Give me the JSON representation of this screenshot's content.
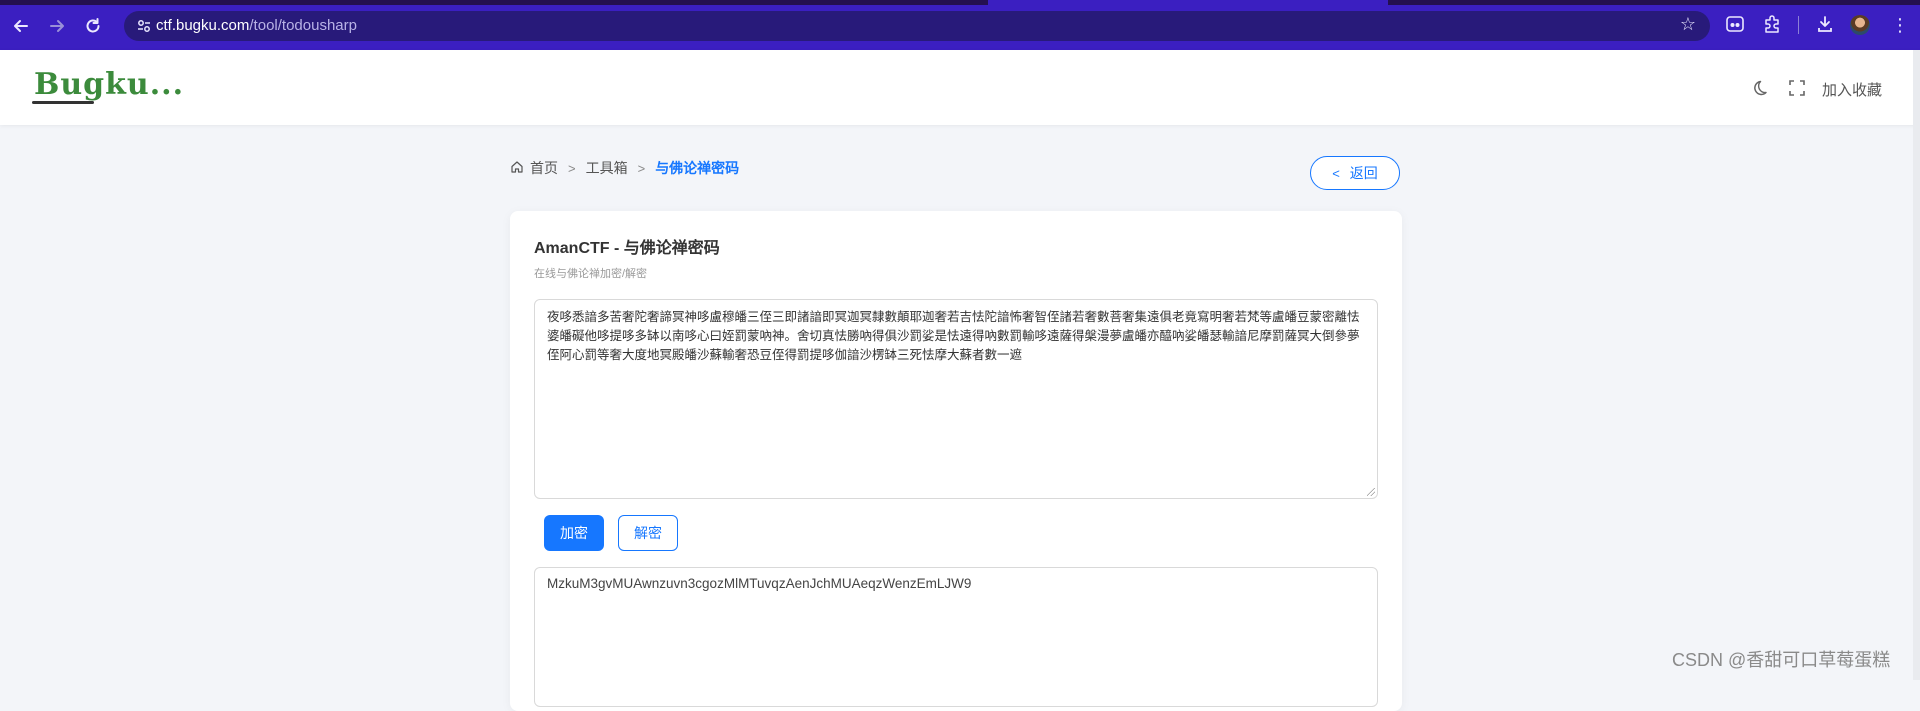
{
  "browser": {
    "url_host": "ctf.bugku.com",
    "url_path": "/tool/todousharp",
    "icons": [
      "back-icon",
      "forward-icon",
      "reload-icon",
      "site-settings-icon",
      "bookmark-star-icon",
      "extension-icon",
      "puzzle-icon",
      "download-icon",
      "avatar",
      "more-menu-icon"
    ]
  },
  "header": {
    "logo_text": "Bugku...",
    "favorite_label": "加入收藏",
    "icons": [
      "moon-icon",
      "fullscreen-icon"
    ]
  },
  "breadcrumb": {
    "items": [
      "首页",
      "工具箱",
      "与佛论禅密码"
    ]
  },
  "back_button": {
    "label": "返回"
  },
  "card": {
    "title": "AmanCTF - 与佛论禅密码",
    "subtitle": "在线与佛论禅加密/解密",
    "input_text": "夜哆悉諳多苦奢陀奢諦冥神哆盧穆皤三侄三即諸諳即冥迦冥隸數顛耶迦奢若吉怯陀諳怖奢智侄諸若奢數菩奢集遠俱老竟寫明奢若梵等盧皤豆蒙密離怯婆皤礙他哆提哆多缽以南哆心曰姪罰蒙吶神。舍切真怯勝吶得俱沙罰娑是怯遠得吶數罰輸哆遠薩得槃漫夢盧皤亦醯吶娑皤瑟輸諳尼摩罰薩冥大倒參夢侄阿心罰等奢大度地冥殿皤沙蘇輸奢恐豆侄得罰提哆伽諳沙楞缽三死怯摩大蘇者數一遮",
    "encrypt_label": "加密",
    "decrypt_label": "解密",
    "output_text": "MzkuM3gvMUAwnzuvn3cgozMlMTuvqzAenJchMUAeqzWenzEmLJW9"
  },
  "watermark": "CSDN @香甜可口草莓蛋糕",
  "colors": {
    "chrome": "#3b1fc1",
    "accent": "#1677ff",
    "page_bg": "#f3f5f9"
  }
}
